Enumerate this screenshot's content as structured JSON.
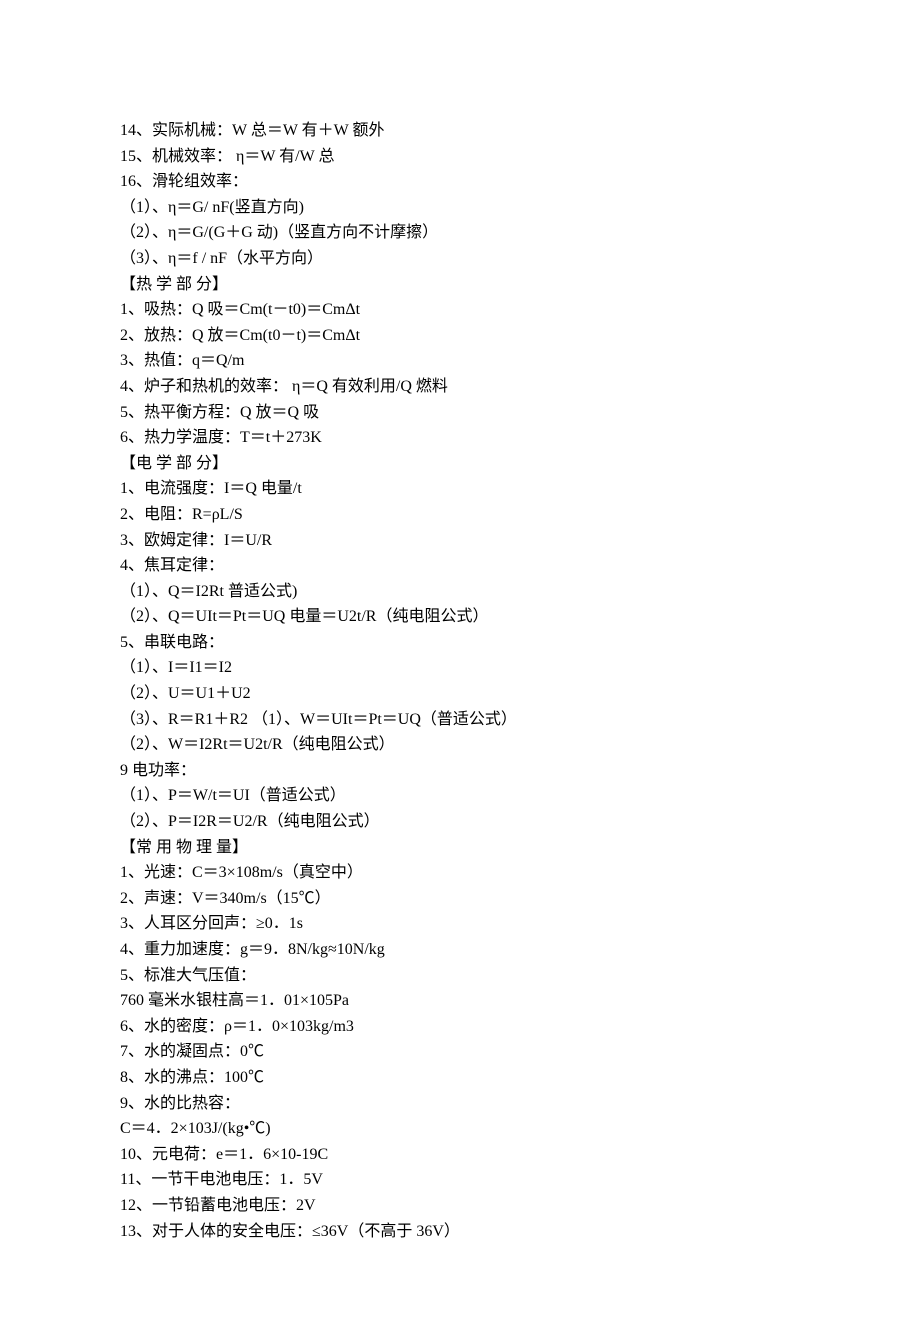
{
  "lines": [
    "14、实际机械：W 总＝W 有＋W 额外",
    "15、机械效率： η＝W 有/W 总",
    "16、滑轮组效率：",
    "（1）、η＝G/ nF(竖直方向)",
    "（2）、η＝G/(G＋G 动)（竖直方向不计摩擦）",
    "（3）、η＝f / nF（水平方向）",
    "【热 学 部 分】",
    "1、吸热：Q 吸＝Cm(t－t0)＝CmΔt",
    "2、放热：Q 放＝Cm(t0－t)＝CmΔt",
    "3、热值：q＝Q/m",
    "4、炉子和热机的效率： η＝Q 有效利用/Q 燃料",
    "5、热平衡方程：Q 放＝Q 吸",
    "6、热力学温度：T＝t＋273K",
    "【电 学 部 分】",
    "1、电流强度：I＝Q 电量/t",
    "2、电阻：R=ρL/S",
    "3、欧姆定律：I＝U/R",
    "4、焦耳定律：",
    "（1）、Q＝I2Rt 普适公式)",
    "（2）、Q＝UIt＝Pt＝UQ 电量＝U2t/R（纯电阻公式）",
    "5、串联电路：",
    "（1）、I＝I1＝I2",
    "（2）、U＝U1＋U2",
    "（3）、R＝R1＋R2 （1）、W＝UIt＝Pt＝UQ（普适公式）",
    "（2）、W＝I2Rt＝U2t/R（纯电阻公式）",
    "9 电功率：",
    "（1）、P＝W/t＝UI（普适公式）",
    "（2）、P＝I2R＝U2/R（纯电阻公式）",
    "【常 用 物 理 量】",
    "1、光速：C＝3×108m/s（真空中）",
    "2、声速：V＝340m/s（15℃）",
    "3、人耳区分回声：≥0．1s",
    "4、重力加速度：g＝9．8N/kg≈10N/kg",
    "5、标准大气压值：",
    "760 毫米水银柱高＝1．01×105Pa",
    "6、水的密度：ρ＝1．0×103kg/m3",
    "7、水的凝固点：0℃",
    "8、水的沸点：100℃",
    "9、水的比热容：",
    "C＝4．2×103J/(kg•℃)",
    "10、元电荷：e＝1．6×10-19C",
    "11、一节干电池电压：1．5V",
    "12、一节铅蓄电池电压：2V",
    "13、对于人体的安全电压：≤36V（不高于 36V）"
  ]
}
